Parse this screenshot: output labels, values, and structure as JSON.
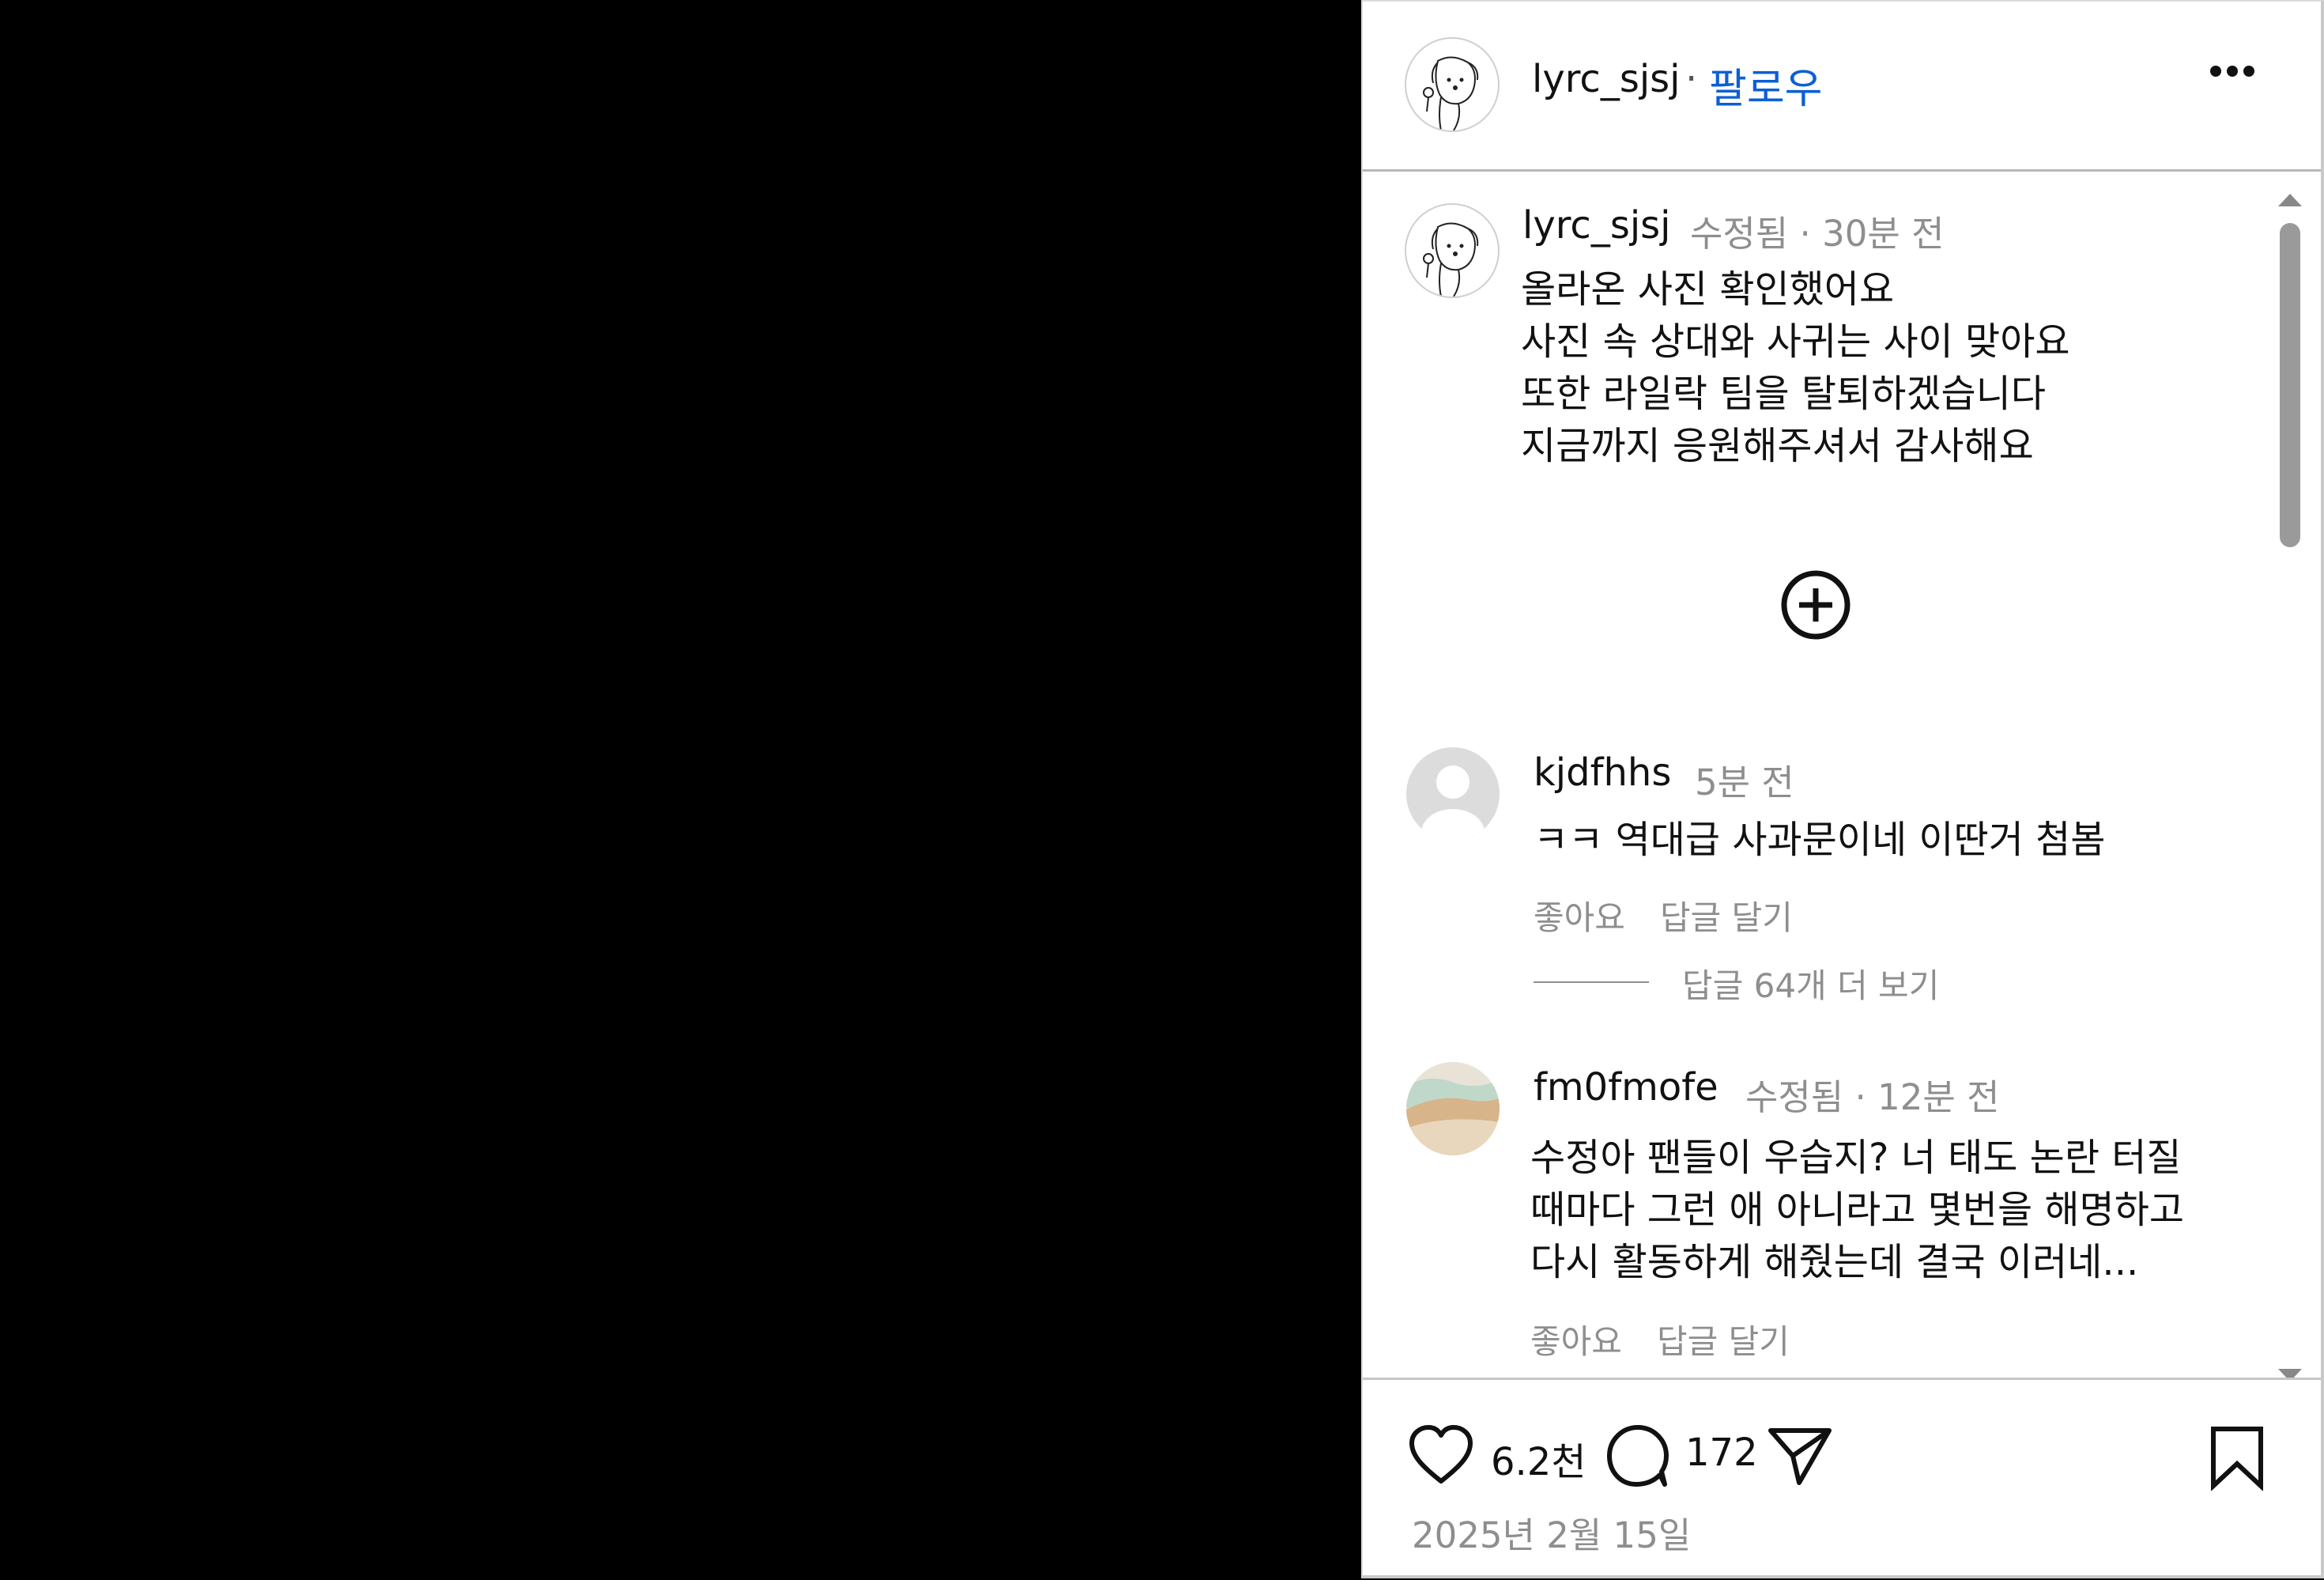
{
  "header": {
    "username": "lyrc_sjsj",
    "separator": "·",
    "follow_label": "팔로우",
    "more_icon": "more-horizontal-icon"
  },
  "caption": {
    "username": "lyrc_sjsj",
    "meta": "수정됨 · 30분 전",
    "text": "올라온 사진 확인했어요\n사진 속 상대와 사귀는 사이 맞아요\n또한 라일락 팀을 탈퇴하겠습니다\n지금까지 응원해주셔서 감사해요",
    "expand_icon": "plus-circle-icon"
  },
  "comments": [
    {
      "username": "kjdfhhs",
      "meta": "5분 전",
      "text": "ㅋㅋ 역대급 사과문이네 이딴거 첨봄",
      "like_label": "좋아요",
      "reply_label": "답글 달기",
      "more_replies": "답글 64개 더 보기"
    },
    {
      "username": "fm0fmofe",
      "meta": "수정됨 · 12분 전",
      "text": "수정아 팬들이 우습지? 너 태도 논란 터질\n때마다 그런 애 아니라고 몇번을 해명하고\n다시 활동하게 해줬는데 결국 이러네...",
      "like_label": "좋아요",
      "reply_label": "답글 달기"
    }
  ],
  "footer": {
    "like_count": "6.2천",
    "comment_count": "172",
    "date": "2025년 2월 15일",
    "icons": [
      "heart-icon",
      "comment-icon",
      "share-icon",
      "bookmark-icon"
    ]
  },
  "colors": {
    "accent": "#0b5fd6",
    "muted": "#8e8e8e",
    "text": "#111111"
  }
}
